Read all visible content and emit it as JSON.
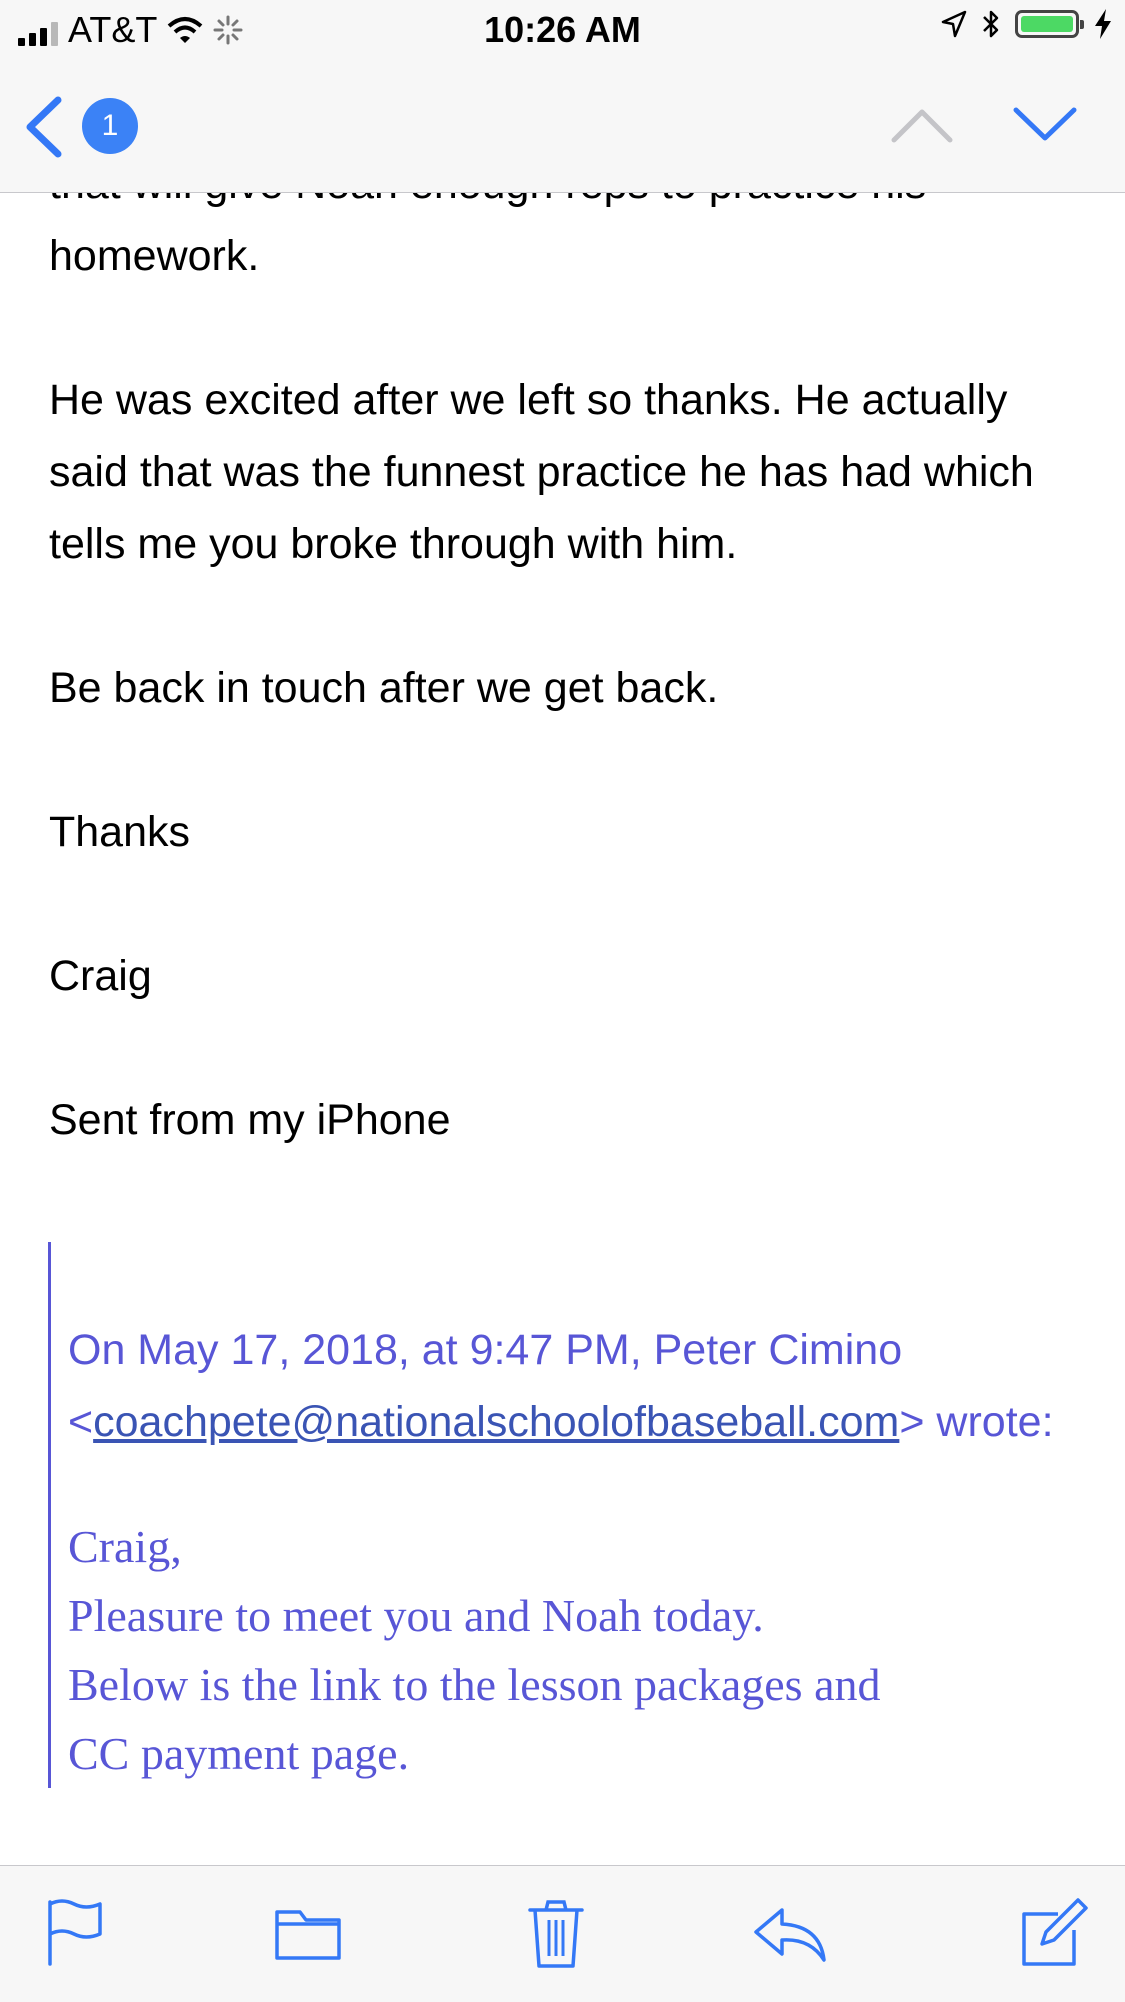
{
  "status_bar": {
    "carrier": "AT&T",
    "time": "10:26 AM",
    "battery_level": 1.0,
    "icons": [
      "signal-icon",
      "wifi-icon",
      "activity-spinner-icon",
      "location-arrow-icon",
      "bluetooth-icon",
      "battery-icon",
      "charging-bolt-icon"
    ]
  },
  "nav": {
    "unread_count": "1",
    "icons": [
      "back-chevron-icon",
      "previous-message-icon",
      "next-message-icon"
    ]
  },
  "email": {
    "paragraphs": [
      "that will give Noah enough reps to practice his homework.",
      "He was excited after we left so thanks. He actually said that was the funnest practice he has had which tells me you broke through with him.",
      "Be back in touch after we get back.",
      "Thanks",
      "Craig",
      "Sent from my iPhone"
    ],
    "quote": {
      "header_prefix": "On May 17, 2018, at 9:47 PM, Peter Cimino <",
      "email_link": "coachpete@nationalschoolofbaseball.com",
      "header_suffix": "> wrote:",
      "lines": [
        "Craig,",
        "Pleasure to meet you and Noah today.",
        "Below is the link to the lesson packages and",
        "CC payment page."
      ]
    }
  },
  "toolbar": {
    "icons": [
      "flag-icon",
      "folder-icon",
      "trash-icon",
      "reply-icon",
      "compose-icon"
    ]
  },
  "colors": {
    "accent": "#3478f6",
    "quote": "#5856d6",
    "battery": "#4cd964",
    "bar_background": "#f7f7f7"
  }
}
